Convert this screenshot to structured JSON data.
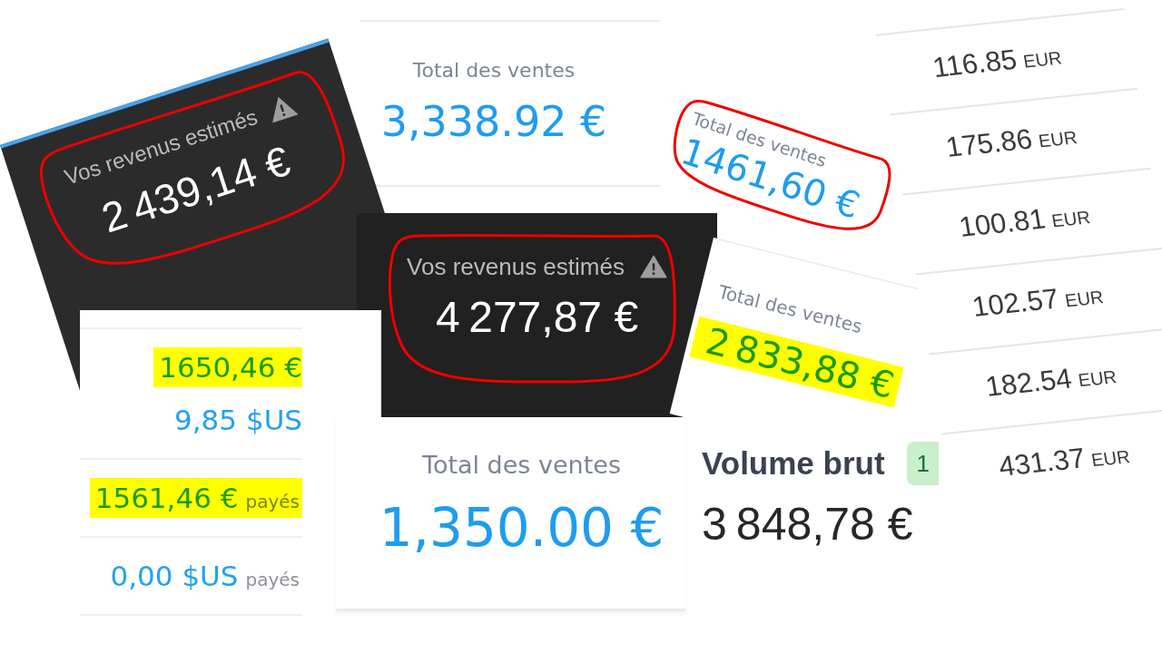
{
  "fragments": [
    {
      "kind": "revenue",
      "label": "Vos revenus estimés",
      "amount": "2 439,14 €",
      "circled": true
    },
    {
      "kind": "sales",
      "label": "Total des ventes",
      "amount": "3,338.92 €",
      "circled": false,
      "highlighted": false
    },
    {
      "kind": "sales",
      "label": "Total des ventes",
      "amount": "1461,60 €",
      "circled": true,
      "highlighted": false
    },
    {
      "kind": "ledger",
      "rows": [
        {
          "amount": "116.85",
          "currency": "EUR"
        },
        {
          "amount": "175.86",
          "currency": "EUR"
        },
        {
          "amount": "100.81",
          "currency": "EUR"
        },
        {
          "amount": "102.57",
          "currency": "EUR"
        },
        {
          "amount": "182.54",
          "currency": "EUR"
        },
        {
          "amount": "431.37",
          "currency": "EUR"
        }
      ]
    },
    {
      "kind": "balances",
      "groups": [
        {
          "lines": [
            {
              "amount": "1650,46 €",
              "highlighted": true
            },
            {
              "amount": "9,85 $US",
              "highlighted": false
            }
          ]
        },
        {
          "lines": [
            {
              "amount": "1561,46 €",
              "note": "payés",
              "highlighted": true
            }
          ]
        },
        {
          "lines": [
            {
              "amount": "0,00 $US",
              "note": "payés",
              "highlighted": false
            }
          ]
        }
      ]
    },
    {
      "kind": "revenue",
      "label": "Vos revenus estimés",
      "amount": "4 277,87 €",
      "circled": true
    },
    {
      "kind": "sales",
      "label": "Total des ventes",
      "amount": "2 833,88 €",
      "circled": false,
      "highlighted": true
    },
    {
      "kind": "sales",
      "label": "Total des ventes",
      "amount": "1,350.00 €",
      "circled": false,
      "highlighted": false
    },
    {
      "kind": "volume",
      "label": "Volume brut",
      "badge": "1",
      "amount": "3 848,78 €"
    }
  ]
}
